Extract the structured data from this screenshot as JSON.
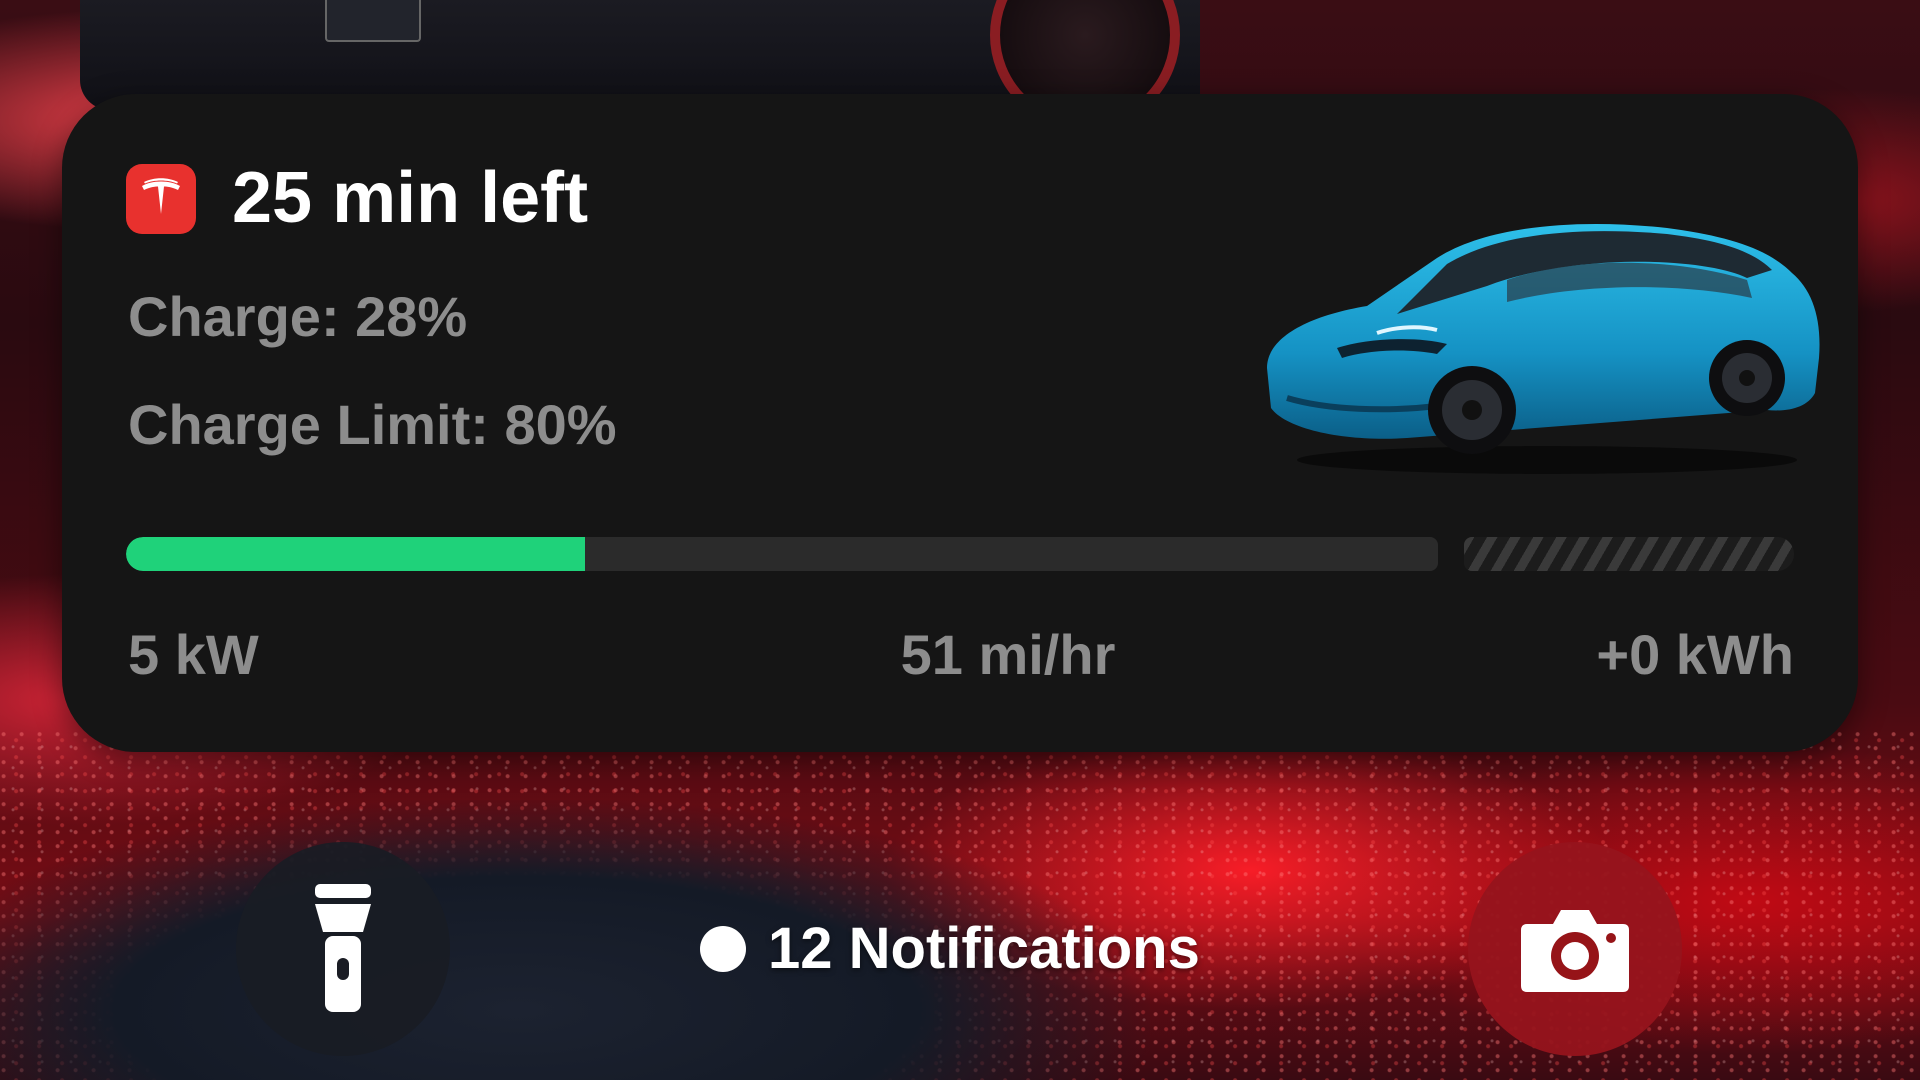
{
  "live_activity": {
    "app_icon": "tesla-logo-icon",
    "title": "25 min left",
    "charge_text": "Charge: 28%",
    "charge_limit_text": "Charge Limit: 80%",
    "charge_percent": 28,
    "charge_limit_percent": 80,
    "car_image": "blue-sedan-image",
    "power": "5 kW",
    "range_rate": "51 mi/hr",
    "energy_added": "+0 kWh",
    "colors": {
      "progress_fill": "#1fd27a",
      "app_icon_bg": "#e8312e",
      "card_bg": "#151515"
    }
  },
  "lock_screen": {
    "flashlight_icon": "flashlight-icon",
    "camera_icon": "camera-icon",
    "notifications_label": "12 Notifications"
  }
}
